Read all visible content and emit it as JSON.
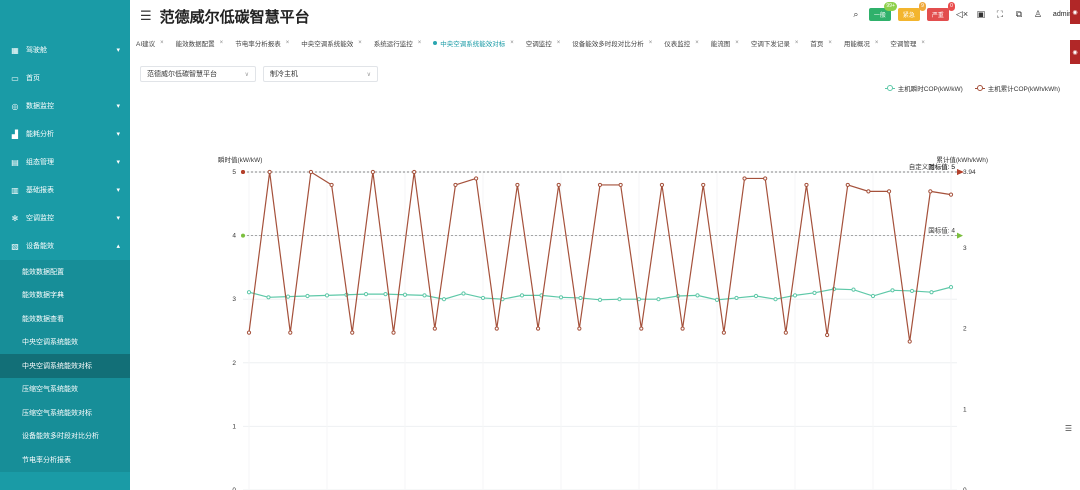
{
  "app": {
    "title": "范德威尔低碳智慧平台",
    "user": "admin"
  },
  "header": {
    "alarms": [
      {
        "label": "一般",
        "count": "99+",
        "color": "#2fb16b"
      },
      {
        "label": "紧急",
        "count": "9",
        "color": "#f3b52e"
      },
      {
        "label": "严重",
        "count": "0",
        "color": "#e24e4e"
      }
    ],
    "icons": [
      "search-icon",
      "mute-icon",
      "screen-icon",
      "fullscreen-icon",
      "layout-icon",
      "shirt-icon"
    ]
  },
  "sidebar": {
    "items": [
      {
        "label": "驾驶舱",
        "icon": "grid-icon",
        "chevron": "▾"
      },
      {
        "label": "首页",
        "icon": "monitor-icon",
        "chevron": ""
      },
      {
        "label": "数据监控",
        "icon": "target-icon",
        "chevron": "▾"
      },
      {
        "label": "能耗分析",
        "icon": "chart-icon",
        "chevron": "▾"
      },
      {
        "label": "组态管理",
        "icon": "layout-icon",
        "chevron": "▾"
      },
      {
        "label": "基础报表",
        "icon": "table-icon",
        "chevron": "▾"
      },
      {
        "label": "空调监控",
        "icon": "snowflake-icon",
        "chevron": "▾"
      },
      {
        "label": "设备能效",
        "icon": "doc-icon",
        "chevron": "▴"
      }
    ],
    "subitems": [
      "能效数据配置",
      "能效数据字典",
      "能效数据查看",
      "中央空调系统能效",
      "中央空调系统能效对标",
      "压缩空气系统能效",
      "压缩空气系统能效对标",
      "设备能效多时段对比分析",
      "节电率分析报表"
    ],
    "active_sub": 4
  },
  "tabs": [
    {
      "label": "AI建议",
      "active": false
    },
    {
      "label": "能效数据配置",
      "active": false
    },
    {
      "label": "节电率分析报表",
      "active": false
    },
    {
      "label": "中央空调系统能效",
      "active": false
    },
    {
      "label": "系统运行监控",
      "active": false
    },
    {
      "label": "中央空调系统能效对标",
      "active": true
    },
    {
      "label": "空调监控",
      "active": false
    },
    {
      "label": "设备能效多时段对比分析",
      "active": false
    },
    {
      "label": "仪表监控",
      "active": false
    },
    {
      "label": "能流图",
      "active": false
    },
    {
      "label": "空调下发记录",
      "active": false
    },
    {
      "label": "首页",
      "active": false
    },
    {
      "label": "用能概况",
      "active": false
    },
    {
      "label": "空调管理",
      "active": false
    }
  ],
  "filters": {
    "org": "范德威尔低碳智慧平台",
    "equipment": "制冷主机"
  },
  "chart_data": {
    "type": "line",
    "legend": [
      "主机瞬时COP(kW/kW)",
      "主机累计COP(kWh/kWh)"
    ],
    "legend_position": "top-right",
    "colors": [
      "#5ec8a8",
      "#a5513b"
    ],
    "y_left": {
      "label": "瞬时值(kW/kW)",
      "min": 0,
      "max": 5,
      "ticks": [
        "0",
        "1",
        "2",
        "3",
        "4",
        "5"
      ]
    },
    "y_right": {
      "label": "累计值(kWh/kWh)",
      "min": 0,
      "max": 3.94,
      "ticks": [
        "0",
        "1",
        "2",
        "3",
        "3.94"
      ]
    },
    "series": [
      {
        "name": "主机瞬时COP(kW/kW)",
        "axis": "left",
        "values": [
          3.11,
          3.03,
          3.04,
          3.05,
          3.06,
          3.07,
          3.08,
          3.08,
          3.07,
          3.06,
          3.0,
          3.09,
          3.02,
          3.0,
          3.06,
          3.06,
          3.03,
          3.02,
          2.99,
          3.0,
          3.0,
          3.0,
          3.05,
          3.06,
          2.99,
          3.02,
          3.05,
          3.0,
          3.06,
          3.1,
          3.16,
          3.15,
          3.05,
          3.14,
          3.13,
          3.11,
          3.19
        ]
      },
      {
        "name": "主机累计COP(kWh/kWh)",
        "axis": "right",
        "values": [
          1.95,
          3.94,
          1.95,
          3.94,
          3.78,
          1.95,
          3.94,
          1.95,
          3.94,
          2.0,
          3.78,
          3.86,
          2.0,
          3.78,
          2.0,
          3.78,
          2.0,
          3.78,
          3.78,
          2.0,
          3.78,
          2.0,
          3.78,
          1.95,
          3.86,
          3.86,
          1.95,
          3.78,
          1.92,
          3.78,
          3.7,
          3.7,
          1.84,
          3.7,
          3.66
        ]
      }
    ],
    "mark_lines": [
      {
        "label": "国标值: 5",
        "value": 5,
        "axis": "left",
        "color": "#d0452e"
      },
      {
        "label": "国标值: 4",
        "value": 4,
        "axis": "left",
        "color": "#7bbf3e"
      },
      {
        "label": "自定义对标值: 5",
        "value": 3.94,
        "axis": "right",
        "color": "#b3402b"
      }
    ],
    "grid": true
  }
}
